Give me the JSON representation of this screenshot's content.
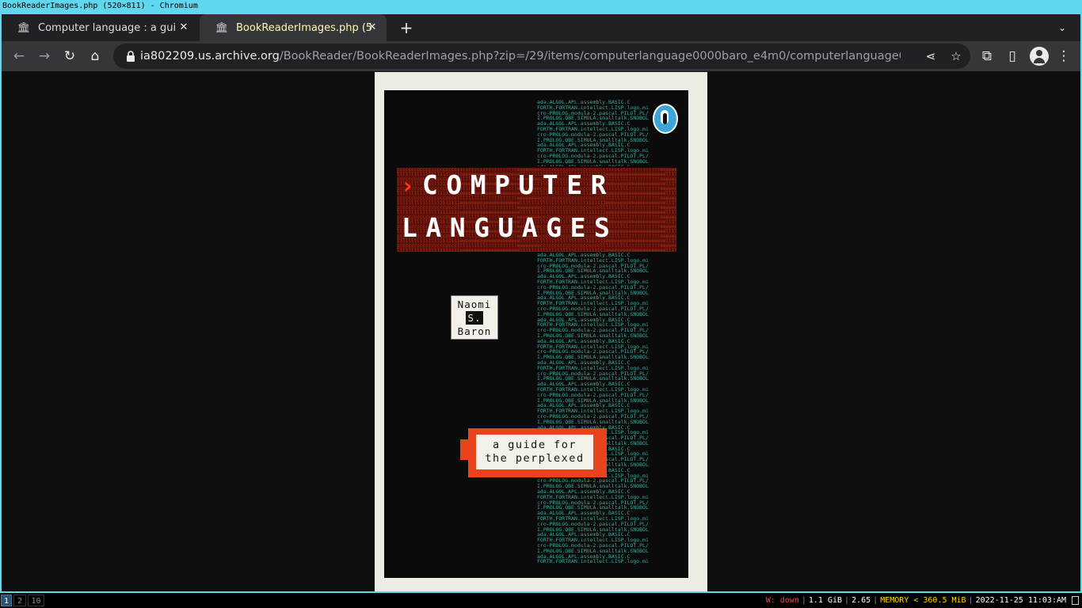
{
  "window_title": "BookReaderImages.php (520×811) - Chromium",
  "tabs": [
    {
      "title": "Computer language : a gui",
      "active": false
    },
    {
      "title": "BookReaderImages.php (5",
      "active": true
    }
  ],
  "omnibox": {
    "host": "ia802209.us.archive.org",
    "path": "/BookReader/BookReaderImages.php?zip=/29/items/computerlanguage0000baro_e4m0/computerlanguage00..."
  },
  "cover": {
    "title_line1": "COMPUTER",
    "title_line2": "LANGUAGES",
    "author_line1": "Naomi",
    "author_line2": "S.",
    "author_line3": "Baron",
    "subtitle_line1": "a guide for",
    "subtitle_line2": "the perplexed",
    "code_lines": [
      "ada.ALGOL.APL.assembly.BASIC.C",
      "FORTH.FORTRAN.intellect.LISP.logo.mi",
      "cro-PROLOG.modula-2.pascal.PILOT.PL/",
      "I.PROLOG.QBE.SIMULA.smalltalk.SNOBOL"
    ]
  },
  "statusbar": {
    "workspaces": [
      "1",
      "2",
      "10"
    ],
    "network": "W: down",
    "disk": "1.1 GiB",
    "load": "2.65",
    "memory": "MEMORY < 360.5 MiB",
    "datetime": "2022-11-25 11:03:AM"
  },
  "colors": {
    "wm_accent": "#5fd7ee",
    "active_tab_text": "#fff7b8",
    "network_down": "#ff4444",
    "memory_warn": "#ffd700",
    "cover_accent": "#e8431a"
  }
}
